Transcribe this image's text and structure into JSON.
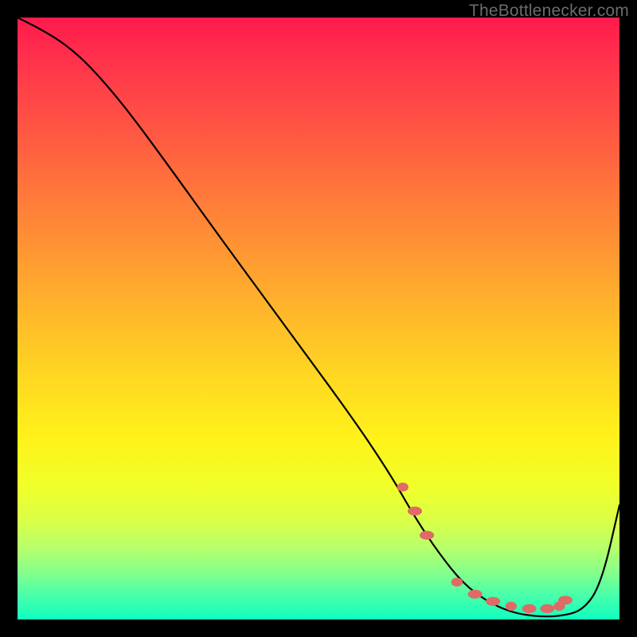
{
  "watermark": "TheBottlenecker.com",
  "chart_data": {
    "type": "line",
    "title": "",
    "xlabel": "",
    "ylabel": "",
    "xlim": [
      0,
      100
    ],
    "ylim": [
      0,
      100
    ],
    "series": [
      {
        "name": "curve",
        "x": [
          0,
          4,
          8,
          12,
          18,
          25,
          34,
          45,
          56,
          62,
          66,
          70,
          74,
          78,
          82,
          86,
          90,
          94,
          97,
          100
        ],
        "y": [
          100,
          98,
          95.5,
          92,
          85,
          75.5,
          63,
          48,
          33,
          24,
          17,
          11,
          6,
          3,
          1.2,
          0.5,
          0.5,
          1.5,
          6,
          19
        ]
      }
    ],
    "markers": {
      "name": "dots",
      "x": [
        64,
        66,
        68,
        73,
        76,
        79,
        82,
        85,
        88,
        90,
        91
      ],
      "y": [
        22,
        18,
        14,
        6.2,
        4.2,
        3.0,
        2.2,
        1.8,
        1.8,
        2.2,
        3.2
      ]
    },
    "marker_color": "#e06a66",
    "curve_color": "#000000"
  }
}
